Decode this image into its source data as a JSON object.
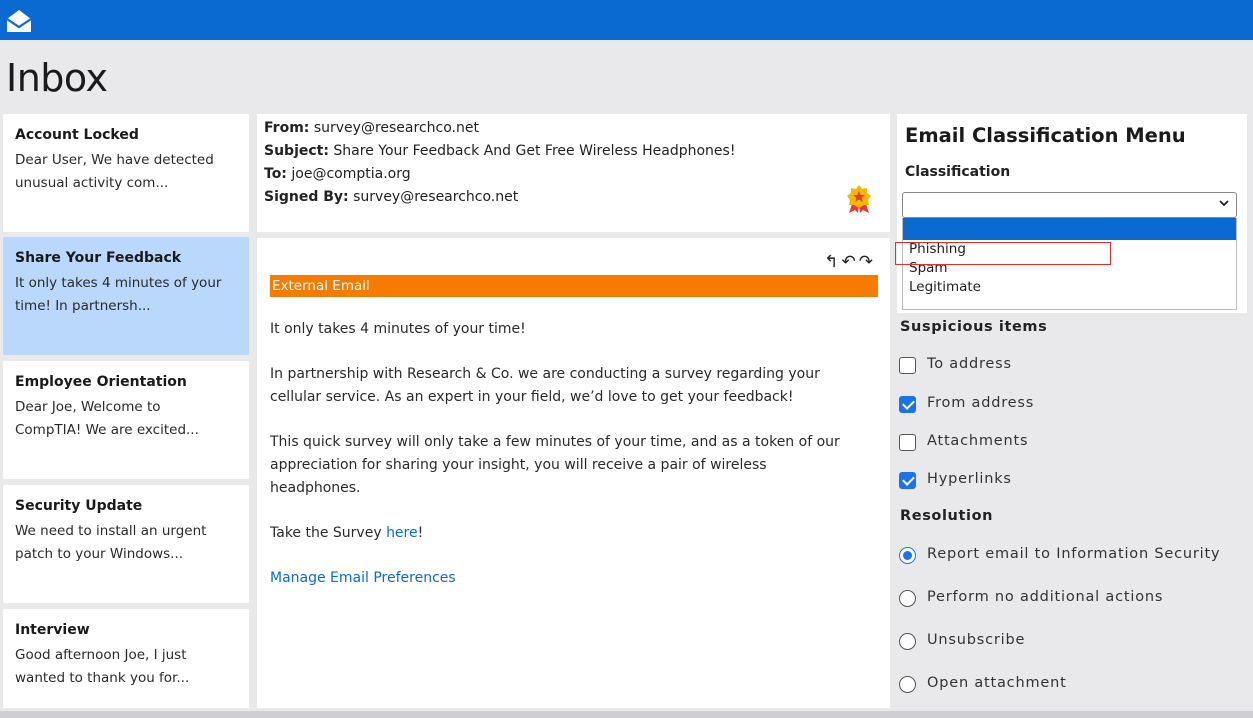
{
  "app": {
    "title": "Inbox"
  },
  "inbox": {
    "items": [
      {
        "title": "Account Locked",
        "preview": "Dear User, We have detected unusual activity com..."
      },
      {
        "title": "Share Your Feedback",
        "preview": "It only takes 4 minutes of your time! In partnersh..."
      },
      {
        "title": "Employee Orientation",
        "preview": "Dear Joe, Welcome to CompTIA! We are excited..."
      },
      {
        "title": "Security Update",
        "preview": "We need to install an urgent patch to your Windows..."
      },
      {
        "title": "Interview",
        "preview": "Good afternoon Joe, I just wanted to thank you for..."
      }
    ],
    "selected_index": 1
  },
  "email": {
    "from_label": "From:",
    "from": "survey@researchco.net",
    "subject_label": "Subject:",
    "subject": "Share Your Feedback And Get Free Wireless Headphones!",
    "to_label": "To:",
    "to": "joe@comptia.org",
    "signed_label": "Signed By:",
    "signed": "survey@researchco.net",
    "actions": {
      "reply": "↰",
      "reply_all": "↶",
      "forward": "↷"
    },
    "banner": "External Email",
    "para1": "It only takes 4 minutes of your time!",
    "para2": "In partnership with Research & Co. we are conducting a survey regarding your cellular service. As an expert in your field, we’d love to get your feedback!",
    "para3": "This quick survey will only take a few minutes of your time, and as a token of our appreciation for sharing your insight, you will receive a pair of wireless headphones.",
    "para4_prefix": "Take the Survey ",
    "para4_link": "here",
    "para4_suffix": "!",
    "manage_link": "Manage Email Preferences"
  },
  "classification": {
    "title": "Email Classification Menu",
    "label": "Classification",
    "selected": "",
    "options": [
      "Phishing",
      "Spam",
      "Legitimate"
    ]
  },
  "suspicious": {
    "label": "Suspicious items",
    "items": [
      {
        "label": "To address",
        "checked": false
      },
      {
        "label": "From address",
        "checked": true
      },
      {
        "label": "Attachments",
        "checked": false
      },
      {
        "label": "Hyperlinks",
        "checked": true
      }
    ]
  },
  "resolution": {
    "label": "Resolution",
    "options": [
      {
        "label": "Report email to Information Security",
        "selected": true
      },
      {
        "label": "Perform no additional actions",
        "selected": false
      },
      {
        "label": "Unsubscribe",
        "selected": false
      },
      {
        "label": "Open attachment",
        "selected": false
      }
    ]
  },
  "colors": {
    "brand": "#0a6ad1",
    "banner": "#f57c00",
    "selected_item": "#b9d8fb",
    "highlight_box": "#e03030"
  }
}
